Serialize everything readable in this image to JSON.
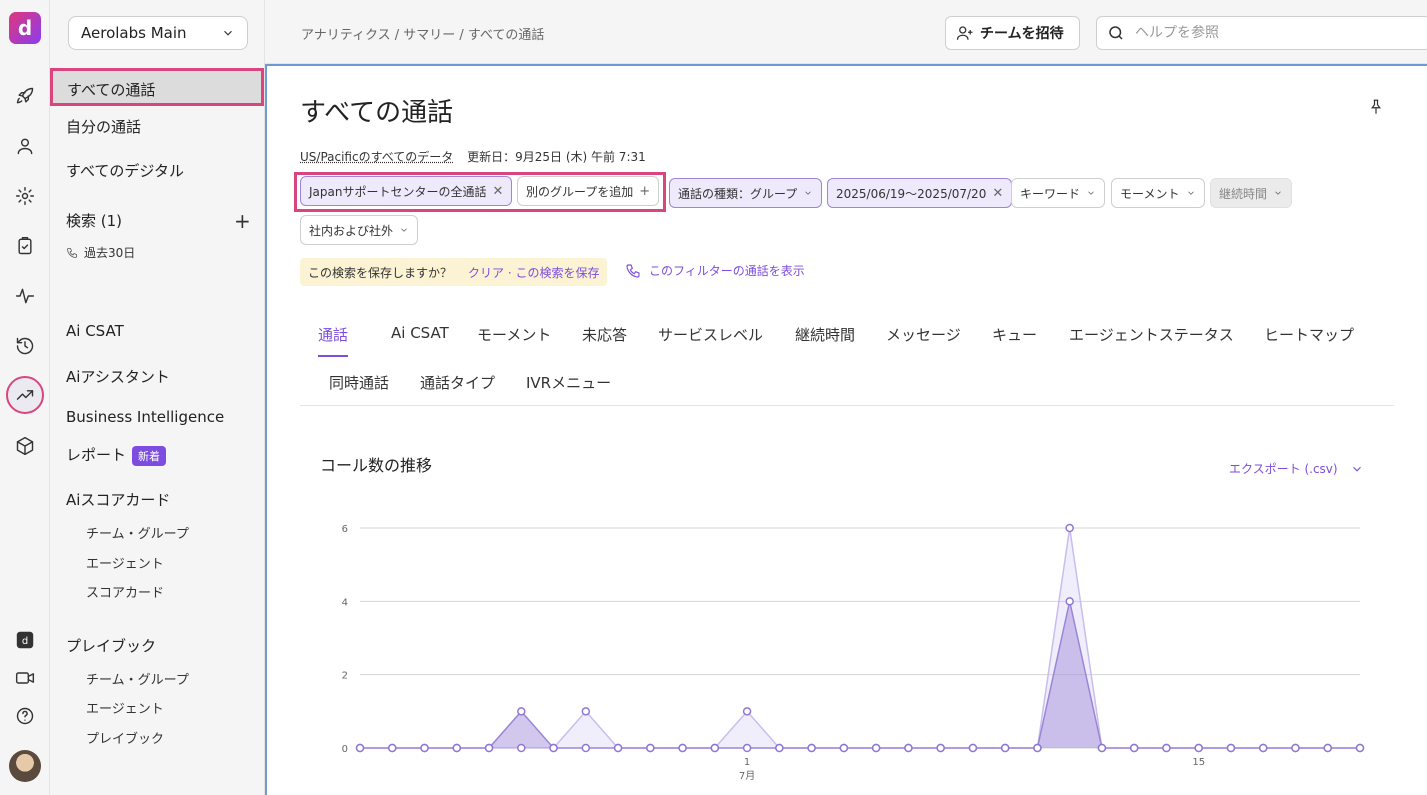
{
  "rail": {
    "logo": "d",
    "icons": [
      "rocket-icon",
      "person-icon",
      "gear-icon",
      "clipboard-icon",
      "activity-icon",
      "history-icon",
      "trending-icon",
      "cube-icon",
      "dialpad-icon",
      "video-icon",
      "help-icon"
    ]
  },
  "sidebar": {
    "workspace": "Aerolabs Main",
    "all_calls": "すべての通話",
    "my_calls": "自分の通話",
    "all_digital": "すべてのデジタル",
    "search_label": "検索 (1)",
    "recent_search": "過去30日",
    "ai_csat": "Ai CSAT",
    "ai_assistant": "Aiアシスタント",
    "bi": "Business Intelligence",
    "reports": "レポート",
    "new_badge": "新着",
    "scorecard": "Aiスコアカード",
    "scorecard_sub": [
      "チーム・グループ",
      "エージェント",
      "スコアカード"
    ],
    "playbook": "プレイブック",
    "playbook_sub": [
      "チーム・グループ",
      "エージェント",
      "プレイブック"
    ]
  },
  "topbar": {
    "breadcrumb": "アナリティクス / サマリー / すべての通話",
    "invite": "チームを招待",
    "search_placeholder": "ヘルプを参照"
  },
  "main": {
    "title": "すべての通話",
    "timezone": "US/Pacificのすべてのデータ",
    "updated": "更新日：9月25日 (木) 午前 7:31",
    "filters": {
      "group": "Japanサポートセンターの全通話",
      "add_group": "別のグループを追加",
      "call_type": "通話の種類：グループ",
      "date_range": "2025/06/19〜2025/07/20",
      "keyword": "キーワード",
      "moment": "モーメント",
      "duration": "継続時間",
      "internal": "社内および社外"
    },
    "save_prompt": "この検索を保存しますか？",
    "save_links": "クリア · この検索を保存",
    "show_calls": "このフィルターの通話を表示",
    "tabs": [
      "通話",
      "Ai CSAT",
      "モーメント",
      "未応答",
      "サービスレベル",
      "継続時間",
      "メッセージ",
      "キュー",
      "エージェントステータス",
      "ヒートマップ",
      "同時通話",
      "通話タイプ",
      "IVRメニュー"
    ],
    "chart_title": "コール数の推移",
    "export": "エクスポート (.csv)"
  },
  "chart_data": {
    "type": "area",
    "title": "コール数の推移",
    "x": [
      "6/19",
      "6/20",
      "6/21",
      "6/22",
      "6/23",
      "6/24",
      "6/25",
      "6/26",
      "6/27",
      "6/28",
      "6/29",
      "6/30",
      "7/1",
      "7/2",
      "7/3",
      "7/4",
      "7/5",
      "7/6",
      "7/7",
      "7/8",
      "7/9",
      "7/10",
      "7/11",
      "7/12",
      "7/13",
      "7/14",
      "7/15",
      "7/16",
      "7/17",
      "7/18",
      "7/19",
      "7/20"
    ],
    "xtick_labels": [
      {
        "index": 12,
        "label": "1",
        "sub": "7月"
      },
      {
        "index": 26,
        "label": "15"
      }
    ],
    "yticks": [
      0,
      2,
      4,
      6
    ],
    "ylim": [
      0,
      6
    ],
    "series": [
      {
        "values": [
          0,
          0,
          0,
          0,
          0,
          1,
          0,
          0,
          0,
          0,
          0,
          0,
          0,
          0,
          0,
          0,
          0,
          0,
          0,
          0,
          0,
          0,
          4,
          0,
          0,
          0,
          0,
          0,
          0,
          0,
          0,
          0
        ],
        "color": "#9b86d6"
      },
      {
        "values": [
          0,
          0,
          0,
          0,
          0,
          0,
          0,
          1,
          0,
          0,
          0,
          0,
          1,
          0,
          0,
          0,
          0,
          0,
          0,
          0,
          0,
          0,
          6,
          0,
          0,
          0,
          0,
          0,
          0,
          0,
          0,
          0
        ],
        "color": "#c9bdf0"
      }
    ]
  }
}
